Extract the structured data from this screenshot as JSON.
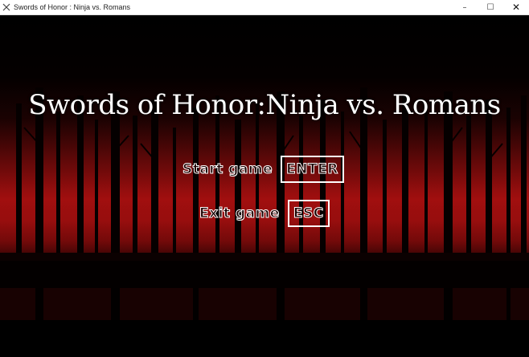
{
  "window": {
    "title": "Swords of Honor : Ninja vs. Romans",
    "icon": "x-app-icon",
    "controls": {
      "minimize": "–",
      "maximize": "☐",
      "close": "✕"
    }
  },
  "game": {
    "title": "Swords of Honor:Ninja vs. Romans",
    "background": "dark red forest silhouette",
    "menu": {
      "start": {
        "label": "Start game",
        "key": "ENTER"
      },
      "exit": {
        "label": "Exit game",
        "key": "ESC"
      }
    }
  },
  "colors": {
    "sky_red": "#9c0e0e",
    "text": "#ffffff",
    "titlebar": "#ffffff"
  }
}
